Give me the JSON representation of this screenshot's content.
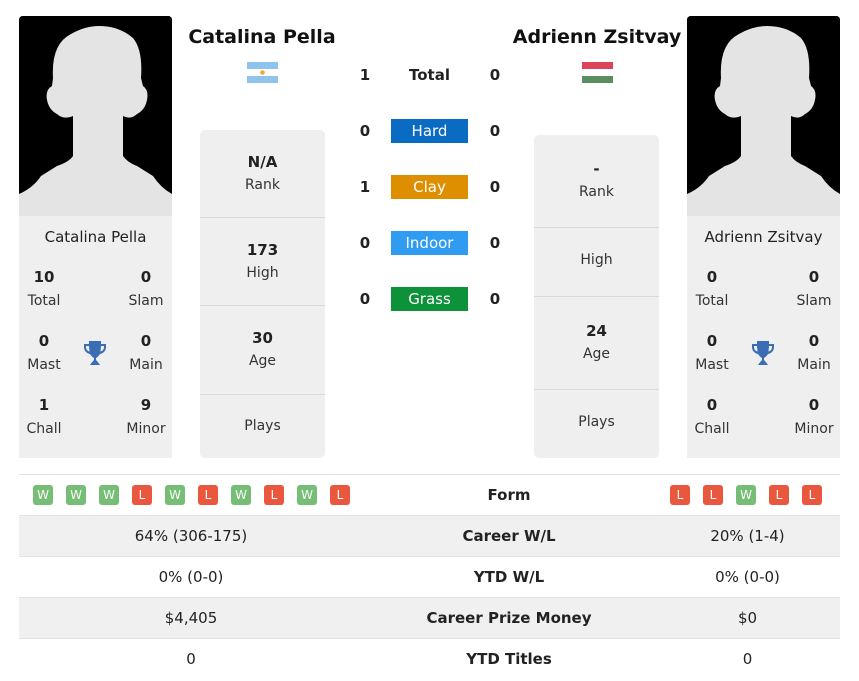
{
  "colors": {
    "hard": "#0a6bc2",
    "clay": "#de8f00",
    "indoor": "#2f9cf2",
    "grass": "#0d9139",
    "win": "#76bd76",
    "loss": "#e9573f",
    "trophy": "#3a6db5"
  },
  "player_left": {
    "name": "Catalina Pella",
    "flag": "argentina-flag",
    "titles": {
      "total": {
        "value": "10",
        "label": "Total"
      },
      "slam": {
        "value": "0",
        "label": "Slam"
      },
      "mast": {
        "value": "0",
        "label": "Mast"
      },
      "main": {
        "value": "0",
        "label": "Main"
      },
      "chall": {
        "value": "1",
        "label": "Chall"
      },
      "minor": {
        "value": "9",
        "label": "Minor"
      }
    },
    "info": {
      "rank": {
        "value": "N/A",
        "label": "Rank"
      },
      "high": {
        "value": "173",
        "label": "High"
      },
      "age": {
        "value": "30",
        "label": "Age"
      },
      "plays": {
        "value": "",
        "label": "Plays"
      }
    },
    "form": [
      "W",
      "W",
      "W",
      "L",
      "W",
      "L",
      "W",
      "L",
      "W",
      "L"
    ]
  },
  "player_right": {
    "name": "Adrienn Zsitvay",
    "flag": "hungary-flag",
    "titles": {
      "total": {
        "value": "0",
        "label": "Total"
      },
      "slam": {
        "value": "0",
        "label": "Slam"
      },
      "mast": {
        "value": "0",
        "label": "Mast"
      },
      "main": {
        "value": "0",
        "label": "Main"
      },
      "chall": {
        "value": "0",
        "label": "Chall"
      },
      "minor": {
        "value": "0",
        "label": "Minor"
      }
    },
    "info": {
      "rank": {
        "value": "-",
        "label": "Rank"
      },
      "high": {
        "value": "",
        "label": "High"
      },
      "age": {
        "value": "24",
        "label": "Age"
      },
      "plays": {
        "value": "",
        "label": "Plays"
      }
    },
    "form": [
      "L",
      "L",
      "W",
      "L",
      "L"
    ]
  },
  "h2h": [
    {
      "label": "Total",
      "left": "1",
      "right": "0"
    },
    {
      "label": "Hard",
      "left": "0",
      "right": "0"
    },
    {
      "label": "Clay",
      "left": "1",
      "right": "0"
    },
    {
      "label": "Indoor",
      "left": "0",
      "right": "0"
    },
    {
      "label": "Grass",
      "left": "0",
      "right": "0"
    }
  ],
  "comparison": [
    {
      "label": "Form",
      "left": "",
      "right": ""
    },
    {
      "label": "Career W/L",
      "left": "64% (306-175)",
      "right": "20% (1-4)"
    },
    {
      "label": "YTD W/L",
      "left": "0% (0-0)",
      "right": "0% (0-0)"
    },
    {
      "label": "Career Prize Money",
      "left": "$4,405",
      "right": "$0"
    },
    {
      "label": "YTD Titles",
      "left": "0",
      "right": "0"
    }
  ]
}
